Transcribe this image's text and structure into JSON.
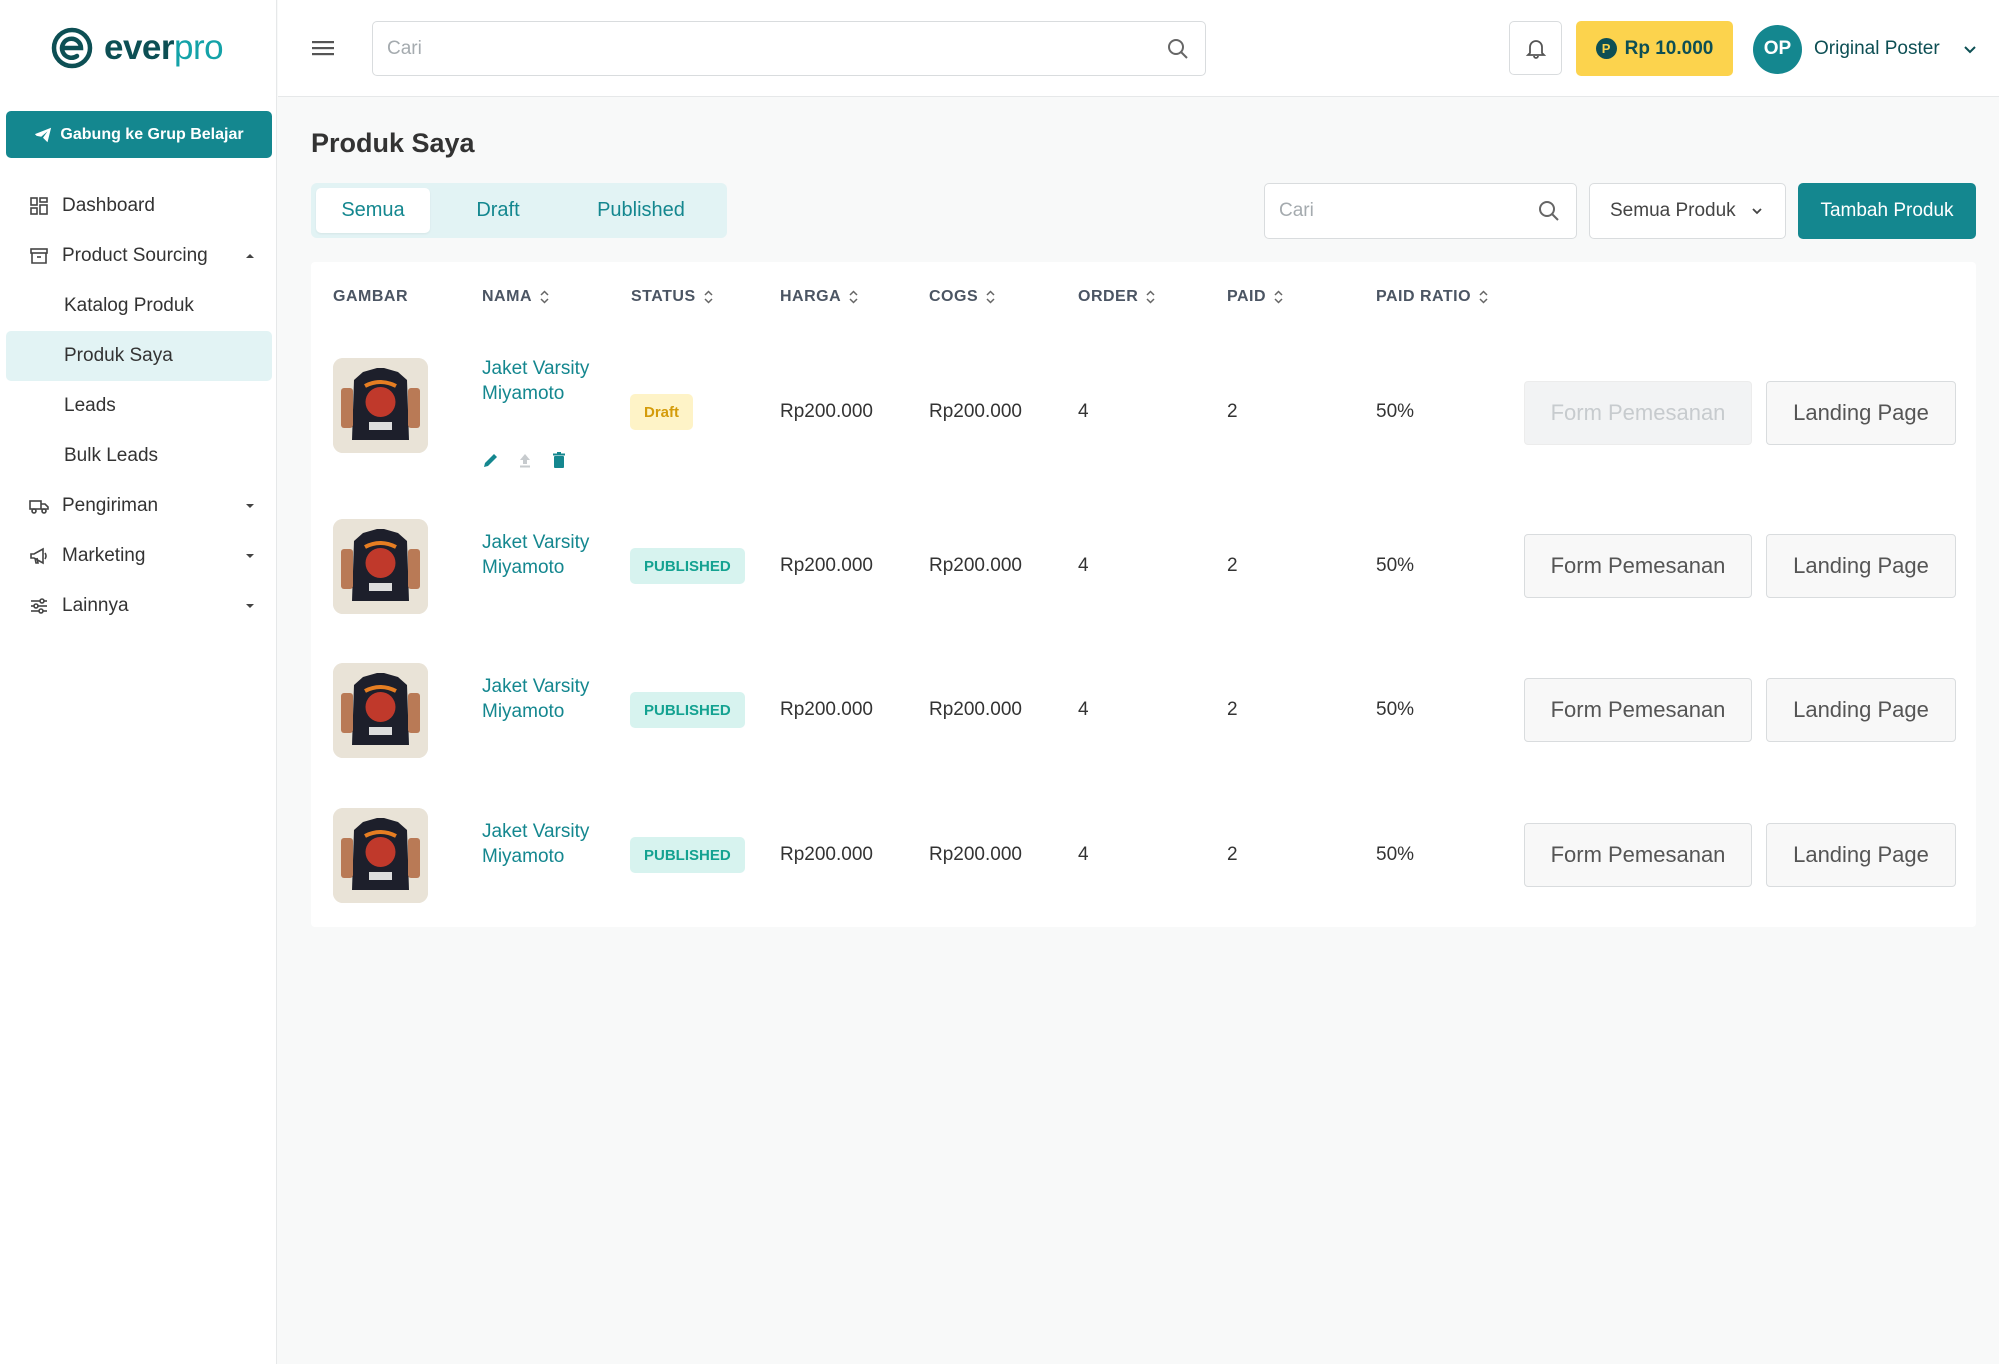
{
  "brand": {
    "name_part1": "ever",
    "name_part2": "pro",
    "colors": {
      "primary": "#14878f",
      "dark": "#0d4f54",
      "accent": "#fcd34d"
    }
  },
  "sidebar": {
    "join_button": "Gabung ke Grup Belajar",
    "items": [
      {
        "label": "Dashboard",
        "icon": "grid-icon"
      },
      {
        "label": "Product Sourcing",
        "icon": "box-icon",
        "expanded": true,
        "children": [
          {
            "label": "Katalog Produk"
          },
          {
            "label": "Produk Saya",
            "active": true
          },
          {
            "label": "Leads"
          },
          {
            "label": "Bulk Leads"
          }
        ]
      },
      {
        "label": "Pengiriman",
        "icon": "truck-icon"
      },
      {
        "label": "Marketing",
        "icon": "megaphone-icon"
      },
      {
        "label": "Lainnya",
        "icon": "sliders-icon"
      }
    ]
  },
  "header": {
    "search_placeholder": "Cari",
    "balance": "Rp 10.000",
    "coin_letter": "P",
    "user": {
      "initials": "OP",
      "name": "Original Poster"
    }
  },
  "main": {
    "title": "Produk Saya",
    "tabs": [
      {
        "label": "Semua",
        "active": true
      },
      {
        "label": "Draft"
      },
      {
        "label": "Published"
      }
    ],
    "search_placeholder": "Cari",
    "filter_value": "Semua Produk",
    "add_button": "Tambah Produk",
    "columns": [
      "GAMBAR",
      "NAMA",
      "STATUS",
      "HARGA",
      "COGS",
      "ORDER",
      "PAID",
      "PAID RATIO"
    ],
    "rows": [
      {
        "name": "Jaket Varsity Miyamoto",
        "status": "Draft",
        "status_type": "draft",
        "harga": "Rp200.000",
        "cogs": "Rp200.000",
        "order": "4",
        "paid": "2",
        "ratio": "50%",
        "form_label": "Form Pemesanan",
        "form_disabled": true,
        "landing_label": "Landing Page",
        "show_actions": true
      },
      {
        "name": "Jaket Varsity Miyamoto",
        "status": "PUBLISHED",
        "status_type": "published",
        "harga": "Rp200.000",
        "cogs": "Rp200.000",
        "order": "4",
        "paid": "2",
        "ratio": "50%",
        "form_label": "Form Pemesanan",
        "form_disabled": false,
        "landing_label": "Landing Page"
      },
      {
        "name": "Jaket Varsity Miyamoto",
        "status": "PUBLISHED",
        "status_type": "published",
        "harga": "Rp200.000",
        "cogs": "Rp200.000",
        "order": "4",
        "paid": "2",
        "ratio": "50%",
        "form_label": "Form Pemesanan",
        "form_disabled": false,
        "landing_label": "Landing Page"
      },
      {
        "name": "Jaket Varsity Miyamoto",
        "status": "PUBLISHED",
        "status_type": "published",
        "harga": "Rp200.000",
        "cogs": "Rp200.000",
        "order": "4",
        "paid": "2",
        "ratio": "50%",
        "form_label": "Form Pemesanan",
        "form_disabled": false,
        "landing_label": "Landing Page"
      }
    ]
  }
}
